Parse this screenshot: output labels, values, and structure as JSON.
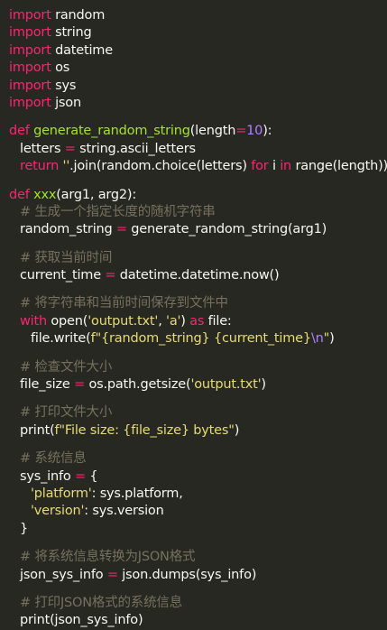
{
  "code": {
    "imports": [
      {
        "kw": "import",
        "mod": " random"
      },
      {
        "kw": "import",
        "mod": " string"
      },
      {
        "kw": "import",
        "mod": " datetime"
      },
      {
        "kw": "import",
        "mod": " os"
      },
      {
        "kw": "import",
        "mod": " sys"
      },
      {
        "kw": "import",
        "mod": " json"
      }
    ],
    "func1": {
      "def": "def",
      "name": "generate_random_string",
      "sig_open": "(length",
      "sig_eq": "=",
      "sig_default": "10",
      "sig_close": "):",
      "line1_var": "letters",
      "line1_eq": " = ",
      "line1_val": "string.ascii_letters",
      "line2_kw": "return",
      "line2_str": " ''",
      "line2_a": ".join(random.choice(letters) ",
      "line2_for": "for",
      "line2_b": " i ",
      "line2_in": "in",
      "line2_c": " range(length))"
    },
    "func2": {
      "def": "def",
      "name": "xxx",
      "sig": "(arg1, arg2):",
      "c1": "# 生成一个指定长度的随机字符串",
      "rs_var": "random_string",
      "rs_eq": " = ",
      "rs_val": "generate_random_string(arg1)",
      "c2": "# 获取当前时间",
      "ct_var": "current_time",
      "ct_eq": " = ",
      "ct_val": "datetime.datetime.now()",
      "c3": "# 将字符串和当前时间保存到文件中",
      "with_kw": "with",
      "with_a": " open(",
      "with_s1": "'output.txt'",
      "with_b": ", ",
      "with_s2": "'a'",
      "with_c": ") ",
      "with_as": "as",
      "with_d": " file:",
      "fw_a": "file.write(",
      "fw_s1": "f\"{random_string} {current_time}",
      "fw_esc": "\\n",
      "fw_s2": "\"",
      "fw_b": ")",
      "c4": "# 检查文件大小",
      "fs_var": "file_size",
      "fs_eq": " = ",
      "fs_val": "os.path.getsize(",
      "fs_str": "'output.txt'",
      "fs_close": ")",
      "c5": "# 打印文件大小",
      "pr_a": "print(",
      "pr_str": "f\"File size: {file_size} bytes\"",
      "pr_b": ")",
      "c6": "# 系统信息",
      "si_var": "sys_info",
      "si_eq": " = ",
      "si_open": "{",
      "si_k1": "'platform'",
      "si_v1": ": sys.platform,",
      "si_k2": "'version'",
      "si_v2": ": sys.version",
      "si_close": "}",
      "c7": "# 将系统信息转换为JSON格式",
      "js_var": "json_sys_info",
      "js_eq": " = ",
      "js_val": "json.dumps(sys_info)",
      "c8": "# 打印JSON格式的系统信息",
      "last": "print(json_sys_info)"
    }
  },
  "colors": {
    "background": "#272822",
    "keyword": "#f92672",
    "function": "#a6e22e",
    "number": "#ae81ff",
    "string": "#e6db74",
    "comment": "#75715e",
    "text": "#f8f8f2"
  }
}
